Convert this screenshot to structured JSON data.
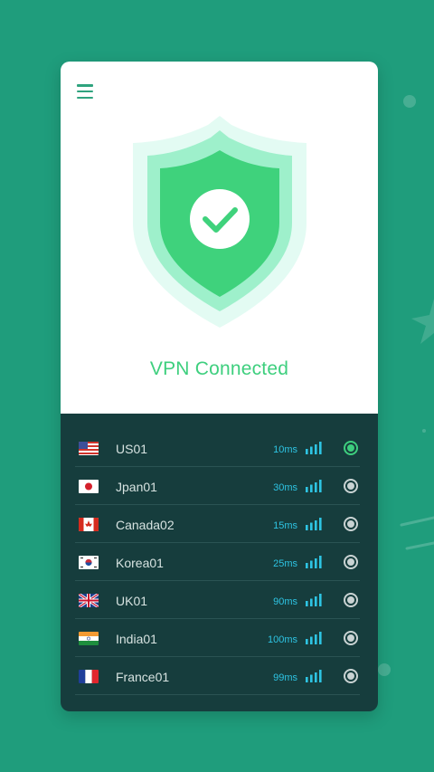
{
  "app": {
    "status_text": "VPN Connected",
    "accent_color": "#3ecf7e",
    "background_color": "#1f9d7c"
  },
  "icons": {
    "menu": "hamburger-menu-icon",
    "shield": "shield-check-icon",
    "signal": "signal-bars-icon"
  },
  "servers": [
    {
      "flag": "us-flag-icon",
      "name": "US01",
      "ping": "10ms",
      "selected": true
    },
    {
      "flag": "japan-flag-icon",
      "name": "Jpan01",
      "ping": "30ms",
      "selected": false
    },
    {
      "flag": "canada-flag-icon",
      "name": "Canada02",
      "ping": "15ms",
      "selected": false
    },
    {
      "flag": "korea-flag-icon",
      "name": "Korea01",
      "ping": "25ms",
      "selected": false
    },
    {
      "flag": "uk-flag-icon",
      "name": "UK01",
      "ping": "90ms",
      "selected": false
    },
    {
      "flag": "india-flag-icon",
      "name": "India01",
      "ping": "100ms",
      "selected": false
    },
    {
      "flag": "france-flag-icon",
      "name": "France01",
      "ping": "99ms",
      "selected": false
    }
  ]
}
